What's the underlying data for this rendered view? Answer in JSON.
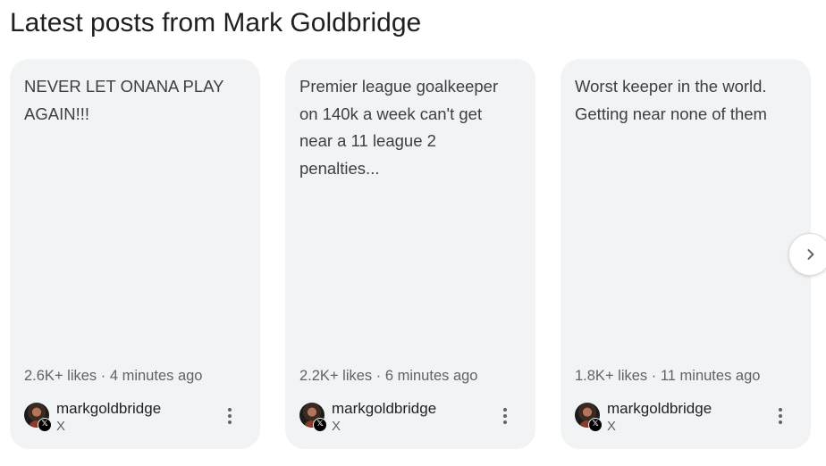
{
  "section": {
    "title": "Latest posts from Mark Goldbridge"
  },
  "posts": [
    {
      "text": "NEVER LET ONANA PLAY AGAIN!!!",
      "meta": "2.6K+ likes · 4 minutes ago",
      "author": "markgoldbridge",
      "source": "X"
    },
    {
      "text": "Premier league goalkeeper on 140k a week can't get near a 11 league 2 penalties...",
      "meta": "2.2K+ likes · 6 minutes ago",
      "author": "markgoldbridge",
      "source": "X"
    },
    {
      "text": "Worst keeper in the world. Getting near none of them",
      "meta": "1.8K+ likes · 11 minutes ago",
      "author": "markgoldbridge",
      "source": "X"
    }
  ],
  "badge": {
    "x_glyph": "𝕏"
  },
  "icons": {
    "avatar": "profile-avatar",
    "badge": "x-logo-icon",
    "more": "more-vert-icon",
    "next": "chevron-right-icon"
  },
  "colors": {
    "card_bg": "#f1f3f4",
    "text": "#3c4043",
    "meta": "#5f6368"
  }
}
